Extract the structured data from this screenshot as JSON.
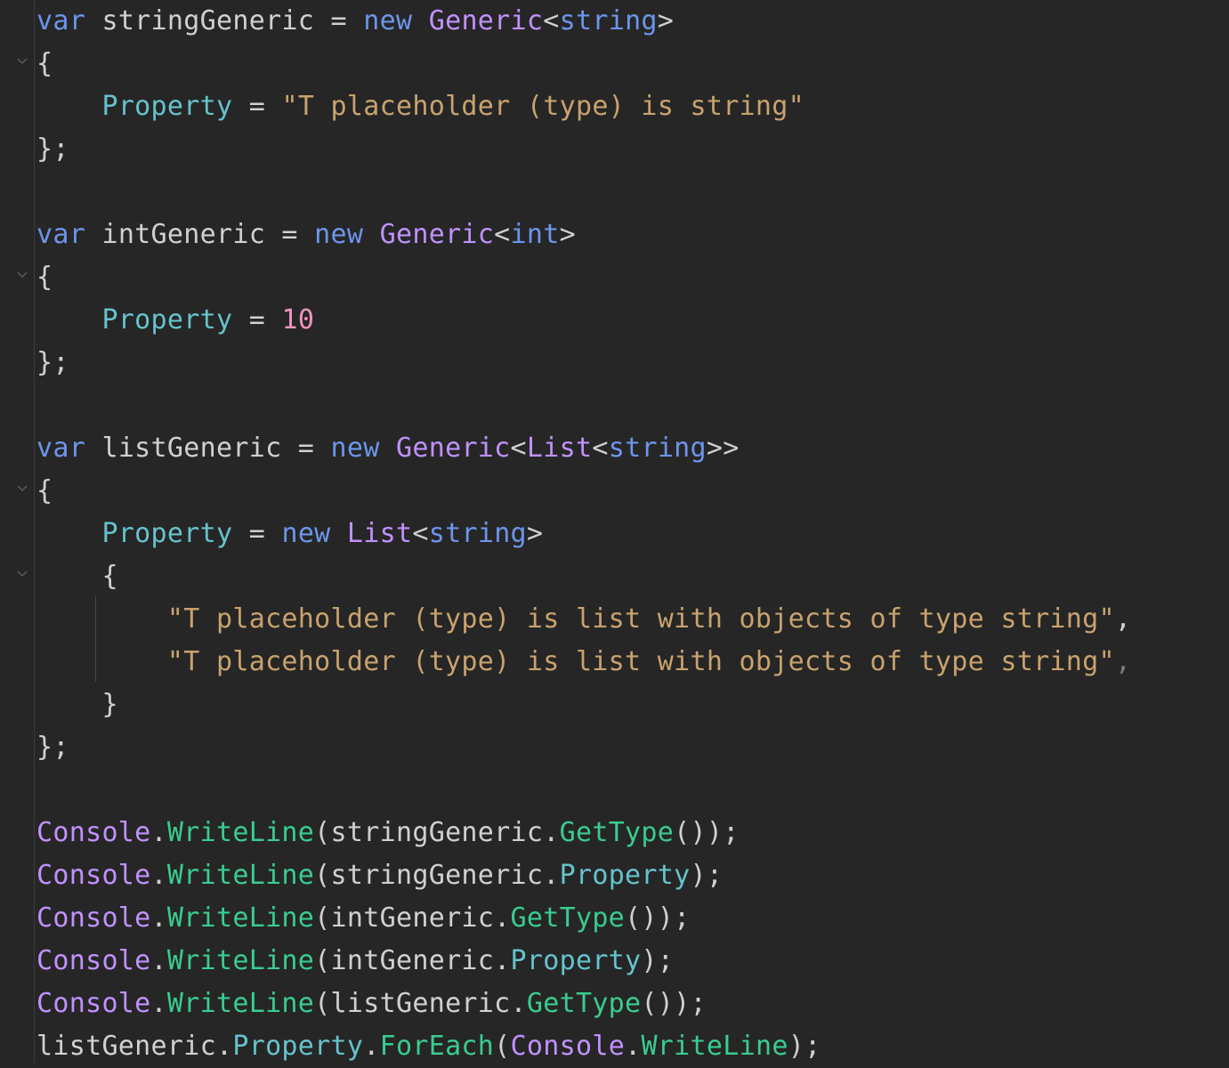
{
  "editor": {
    "background": "#262626",
    "colors": {
      "keyword": "#6c95eb",
      "type": "#c191ff",
      "property": "#66c3cc",
      "string": "#c9a26d",
      "number": "#ed94c0",
      "method": "#39cc8f",
      "default": "#d0d0d0"
    },
    "lines": [
      [
        [
          "kw",
          "var"
        ],
        [
          "df",
          " stringGeneric = "
        ],
        [
          "kw",
          "new"
        ],
        [
          "df",
          " "
        ],
        [
          "tp",
          "Generic"
        ],
        [
          "df",
          "<"
        ],
        [
          "kw",
          "string"
        ],
        [
          "df",
          ">"
        ]
      ],
      [
        [
          "df",
          "{"
        ]
      ],
      [
        [
          "df",
          "    "
        ],
        [
          "pr",
          "Property"
        ],
        [
          "df",
          " = "
        ],
        [
          "st",
          "\"T placeholder (type) is string\""
        ]
      ],
      [
        [
          "df",
          "};"
        ]
      ],
      [],
      [
        [
          "kw",
          "var"
        ],
        [
          "df",
          " intGeneric = "
        ],
        [
          "kw",
          "new"
        ],
        [
          "df",
          " "
        ],
        [
          "tp",
          "Generic"
        ],
        [
          "df",
          "<"
        ],
        [
          "kw",
          "int"
        ],
        [
          "df",
          ">"
        ]
      ],
      [
        [
          "df",
          "{"
        ]
      ],
      [
        [
          "df",
          "    "
        ],
        [
          "pr",
          "Property"
        ],
        [
          "df",
          " = "
        ],
        [
          "nm",
          "10"
        ]
      ],
      [
        [
          "df",
          "};"
        ]
      ],
      [],
      [
        [
          "kw",
          "var"
        ],
        [
          "df",
          " listGeneric = "
        ],
        [
          "kw",
          "new"
        ],
        [
          "df",
          " "
        ],
        [
          "tp",
          "Generic"
        ],
        [
          "df",
          "<"
        ],
        [
          "tp",
          "List"
        ],
        [
          "df",
          "<"
        ],
        [
          "kw",
          "string"
        ],
        [
          "df",
          ">>"
        ]
      ],
      [
        [
          "df",
          "{"
        ]
      ],
      [
        [
          "df",
          "    "
        ],
        [
          "pr",
          "Property"
        ],
        [
          "df",
          " = "
        ],
        [
          "kw",
          "new"
        ],
        [
          "df",
          " "
        ],
        [
          "tp",
          "List"
        ],
        [
          "df",
          "<"
        ],
        [
          "kw",
          "string"
        ],
        [
          "df",
          ">"
        ]
      ],
      [
        [
          "df",
          "    {"
        ]
      ],
      [
        [
          "df",
          "        "
        ],
        [
          "st",
          "\"T placeholder (type) is list with objects of type string\""
        ],
        [
          "df",
          ","
        ]
      ],
      [
        [
          "df",
          "        "
        ],
        [
          "st",
          "\"T placeholder (type) is list with objects of type string\""
        ],
        [
          "dim",
          ","
        ]
      ],
      [
        [
          "df",
          "    }"
        ]
      ],
      [
        [
          "df",
          "};"
        ]
      ],
      [],
      [
        [
          "tp",
          "Console"
        ],
        [
          "df",
          "."
        ],
        [
          "mt",
          "WriteLine"
        ],
        [
          "df",
          "(stringGeneric."
        ],
        [
          "mt",
          "GetType"
        ],
        [
          "df",
          "());"
        ]
      ],
      [
        [
          "tp",
          "Console"
        ],
        [
          "df",
          "."
        ],
        [
          "mt",
          "WriteLine"
        ],
        [
          "df",
          "(stringGeneric."
        ],
        [
          "pr",
          "Property"
        ],
        [
          "df",
          ");"
        ]
      ],
      [
        [
          "tp",
          "Console"
        ],
        [
          "df",
          "."
        ],
        [
          "mt",
          "WriteLine"
        ],
        [
          "df",
          "(intGeneric."
        ],
        [
          "mt",
          "GetType"
        ],
        [
          "df",
          "());"
        ]
      ],
      [
        [
          "tp",
          "Console"
        ],
        [
          "df",
          "."
        ],
        [
          "mt",
          "WriteLine"
        ],
        [
          "df",
          "(intGeneric."
        ],
        [
          "pr",
          "Property"
        ],
        [
          "df",
          ");"
        ]
      ],
      [
        [
          "tp",
          "Console"
        ],
        [
          "df",
          "."
        ],
        [
          "mt",
          "WriteLine"
        ],
        [
          "df",
          "(listGeneric."
        ],
        [
          "mt",
          "GetType"
        ],
        [
          "df",
          "());"
        ]
      ],
      [
        [
          "df",
          "listGeneric."
        ],
        [
          "pr",
          "Property"
        ],
        [
          "df",
          "."
        ],
        [
          "mt",
          "ForEach"
        ],
        [
          "df",
          "("
        ],
        [
          "tp",
          "Console"
        ],
        [
          "df",
          "."
        ],
        [
          "mt",
          "WriteLine"
        ],
        [
          "df",
          ");"
        ]
      ]
    ],
    "fold_markers": [
      "chevron-down-icon",
      "chevron-down-icon",
      "chevron-down-icon",
      "chevron-down-icon"
    ]
  }
}
